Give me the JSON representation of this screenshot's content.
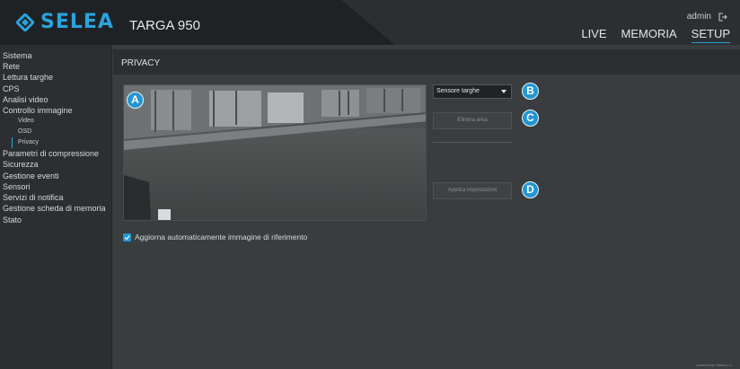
{
  "header": {
    "brand": "SELEA",
    "product": "TARGA 950",
    "user": "admin",
    "nav": [
      "LIVE",
      "MEMORIA",
      "SETUP"
    ],
    "active_nav": "SETUP",
    "accent_color": "#2aa3dc",
    "logout_icon": "logout-icon"
  },
  "sidebar": {
    "items": [
      "Sistema",
      "Rete",
      "Lettura targhe",
      "CPS",
      "Analisi video",
      "Controllo immagine",
      "Video",
      "OSD",
      "Privacy",
      "Parametri di compressione",
      "Sicurezza",
      "Gestione eventi",
      "Sensori",
      "Servizi di notifica",
      "Gestione scheda di memoria",
      "Stato"
    ],
    "active_item": "Privacy"
  },
  "main": {
    "title": "PRIVACY",
    "sensor_select": "Sensore targhe",
    "clear_button": "Elimina area",
    "apply_button": "Applica impostazioni",
    "auto_refresh_label": "Aggiorna automaticamente immagine di riferimento",
    "auto_refresh_checked": true,
    "callouts": [
      "A",
      "B",
      "C",
      "D"
    ]
  },
  "footer": {
    "powered": "powered by Selea s.r.l."
  }
}
